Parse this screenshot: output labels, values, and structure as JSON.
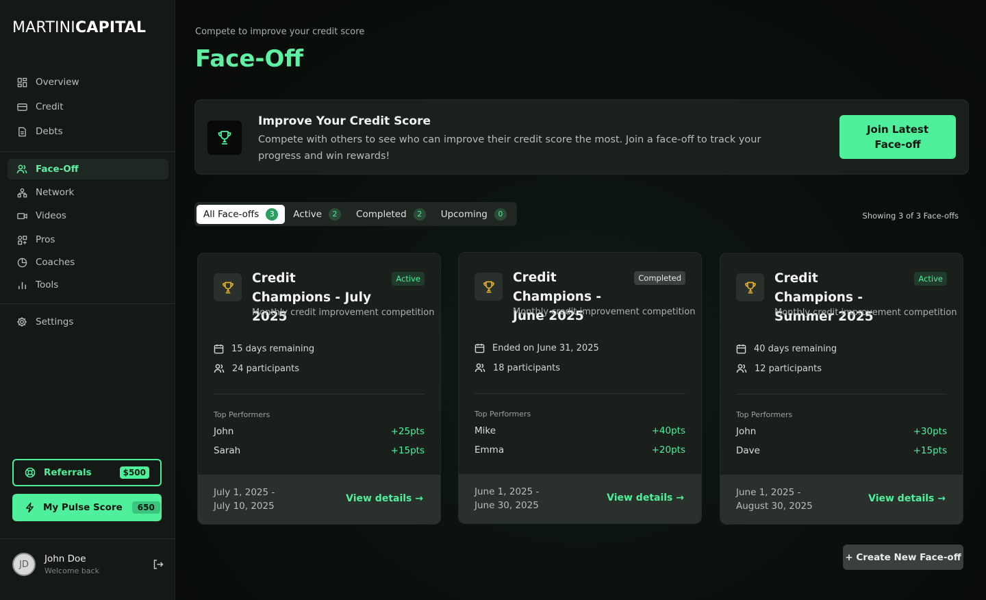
{
  "brand": {
    "part1": "MARTINI",
    "part2": "CAPITAL"
  },
  "sidebar": {
    "items": [
      {
        "label": "Overview",
        "icon": "grid-icon"
      },
      {
        "label": "Credit",
        "icon": "credit-card-icon"
      },
      {
        "label": "Debts",
        "icon": "document-icon"
      },
      {
        "label": "Face-Off",
        "icon": "users-icon",
        "active": true
      },
      {
        "label": "Network",
        "icon": "network-icon"
      },
      {
        "label": "Videos",
        "icon": "video-icon"
      },
      {
        "label": "Pros",
        "icon": "apps-icon"
      },
      {
        "label": "Coaches",
        "icon": "pie-icon"
      },
      {
        "label": "Tools",
        "icon": "bar-chart-icon"
      },
      {
        "label": "Settings",
        "icon": "gear-icon"
      }
    ],
    "referrals": {
      "label": "Referrals",
      "badge": "$500"
    },
    "pulse": {
      "label": "My Pulse Score",
      "badge": "650"
    },
    "user": {
      "initials": "JD",
      "name": "John Doe",
      "sub": "Welcome back"
    }
  },
  "header": {
    "subtitle": "Compete to improve your credit score",
    "title": "Face-Off"
  },
  "banner": {
    "title": "Improve Your Credit Score",
    "text": "Compete with others to see who can improve their credit score the most. Join a face-off to track your progress and win rewards!",
    "button": "Join Latest Face-off"
  },
  "tabs": [
    {
      "label": "All Face-offs",
      "count": "3",
      "active": true
    },
    {
      "label": "Active",
      "count": "2"
    },
    {
      "label": "Completed",
      "count": "2"
    },
    {
      "label": "Upcoming",
      "count": "0"
    }
  ],
  "showing": "Showing 3 of 3 Face-offs",
  "cards": [
    {
      "title": "Credit Champions - July 2025",
      "badge": "Active",
      "desc": "Monthly credit improvement competition",
      "remaining": "15 days remaining",
      "participants": "24 participants",
      "tp_label": "Top Performers",
      "performers": [
        {
          "name": "John",
          "pts": "+25pts"
        },
        {
          "name": "Sarah",
          "pts": "+15pts"
        }
      ],
      "date_start": "July 1, 2025 -",
      "date_end": "July 10, 2025",
      "link": "View details →"
    },
    {
      "title": "Credit Champions - June 2025",
      "badge": "Completed",
      "desc": "Monthly credit improvement competition",
      "remaining": "Ended on June 31, 2025",
      "participants": "18 participants",
      "tp_label": "Top Performers",
      "performers": [
        {
          "name": "Mike",
          "pts": "+40pts"
        },
        {
          "name": "Emma",
          "pts": "+20pts"
        }
      ],
      "date_start": "June 1, 2025 -",
      "date_end": "June 30, 2025",
      "link": "View details →"
    },
    {
      "title": "Credit Champions - Summer 2025",
      "badge": "Active",
      "desc": "Monthly credit improvement competition",
      "remaining": "40 days remaining",
      "participants": "12 participants",
      "tp_label": "Top Performers",
      "performers": [
        {
          "name": "John",
          "pts": "+30pts"
        },
        {
          "name": "Dave",
          "pts": "+15pts"
        }
      ],
      "date_start": "June 1, 2025 -",
      "date_end": "August 30, 2025",
      "link": "View details →"
    }
  ],
  "create_button": "+ Create New Face-off",
  "colors": {
    "accent": "#4ef09b",
    "background": "#0b100e",
    "card": "#1a1f1c"
  }
}
